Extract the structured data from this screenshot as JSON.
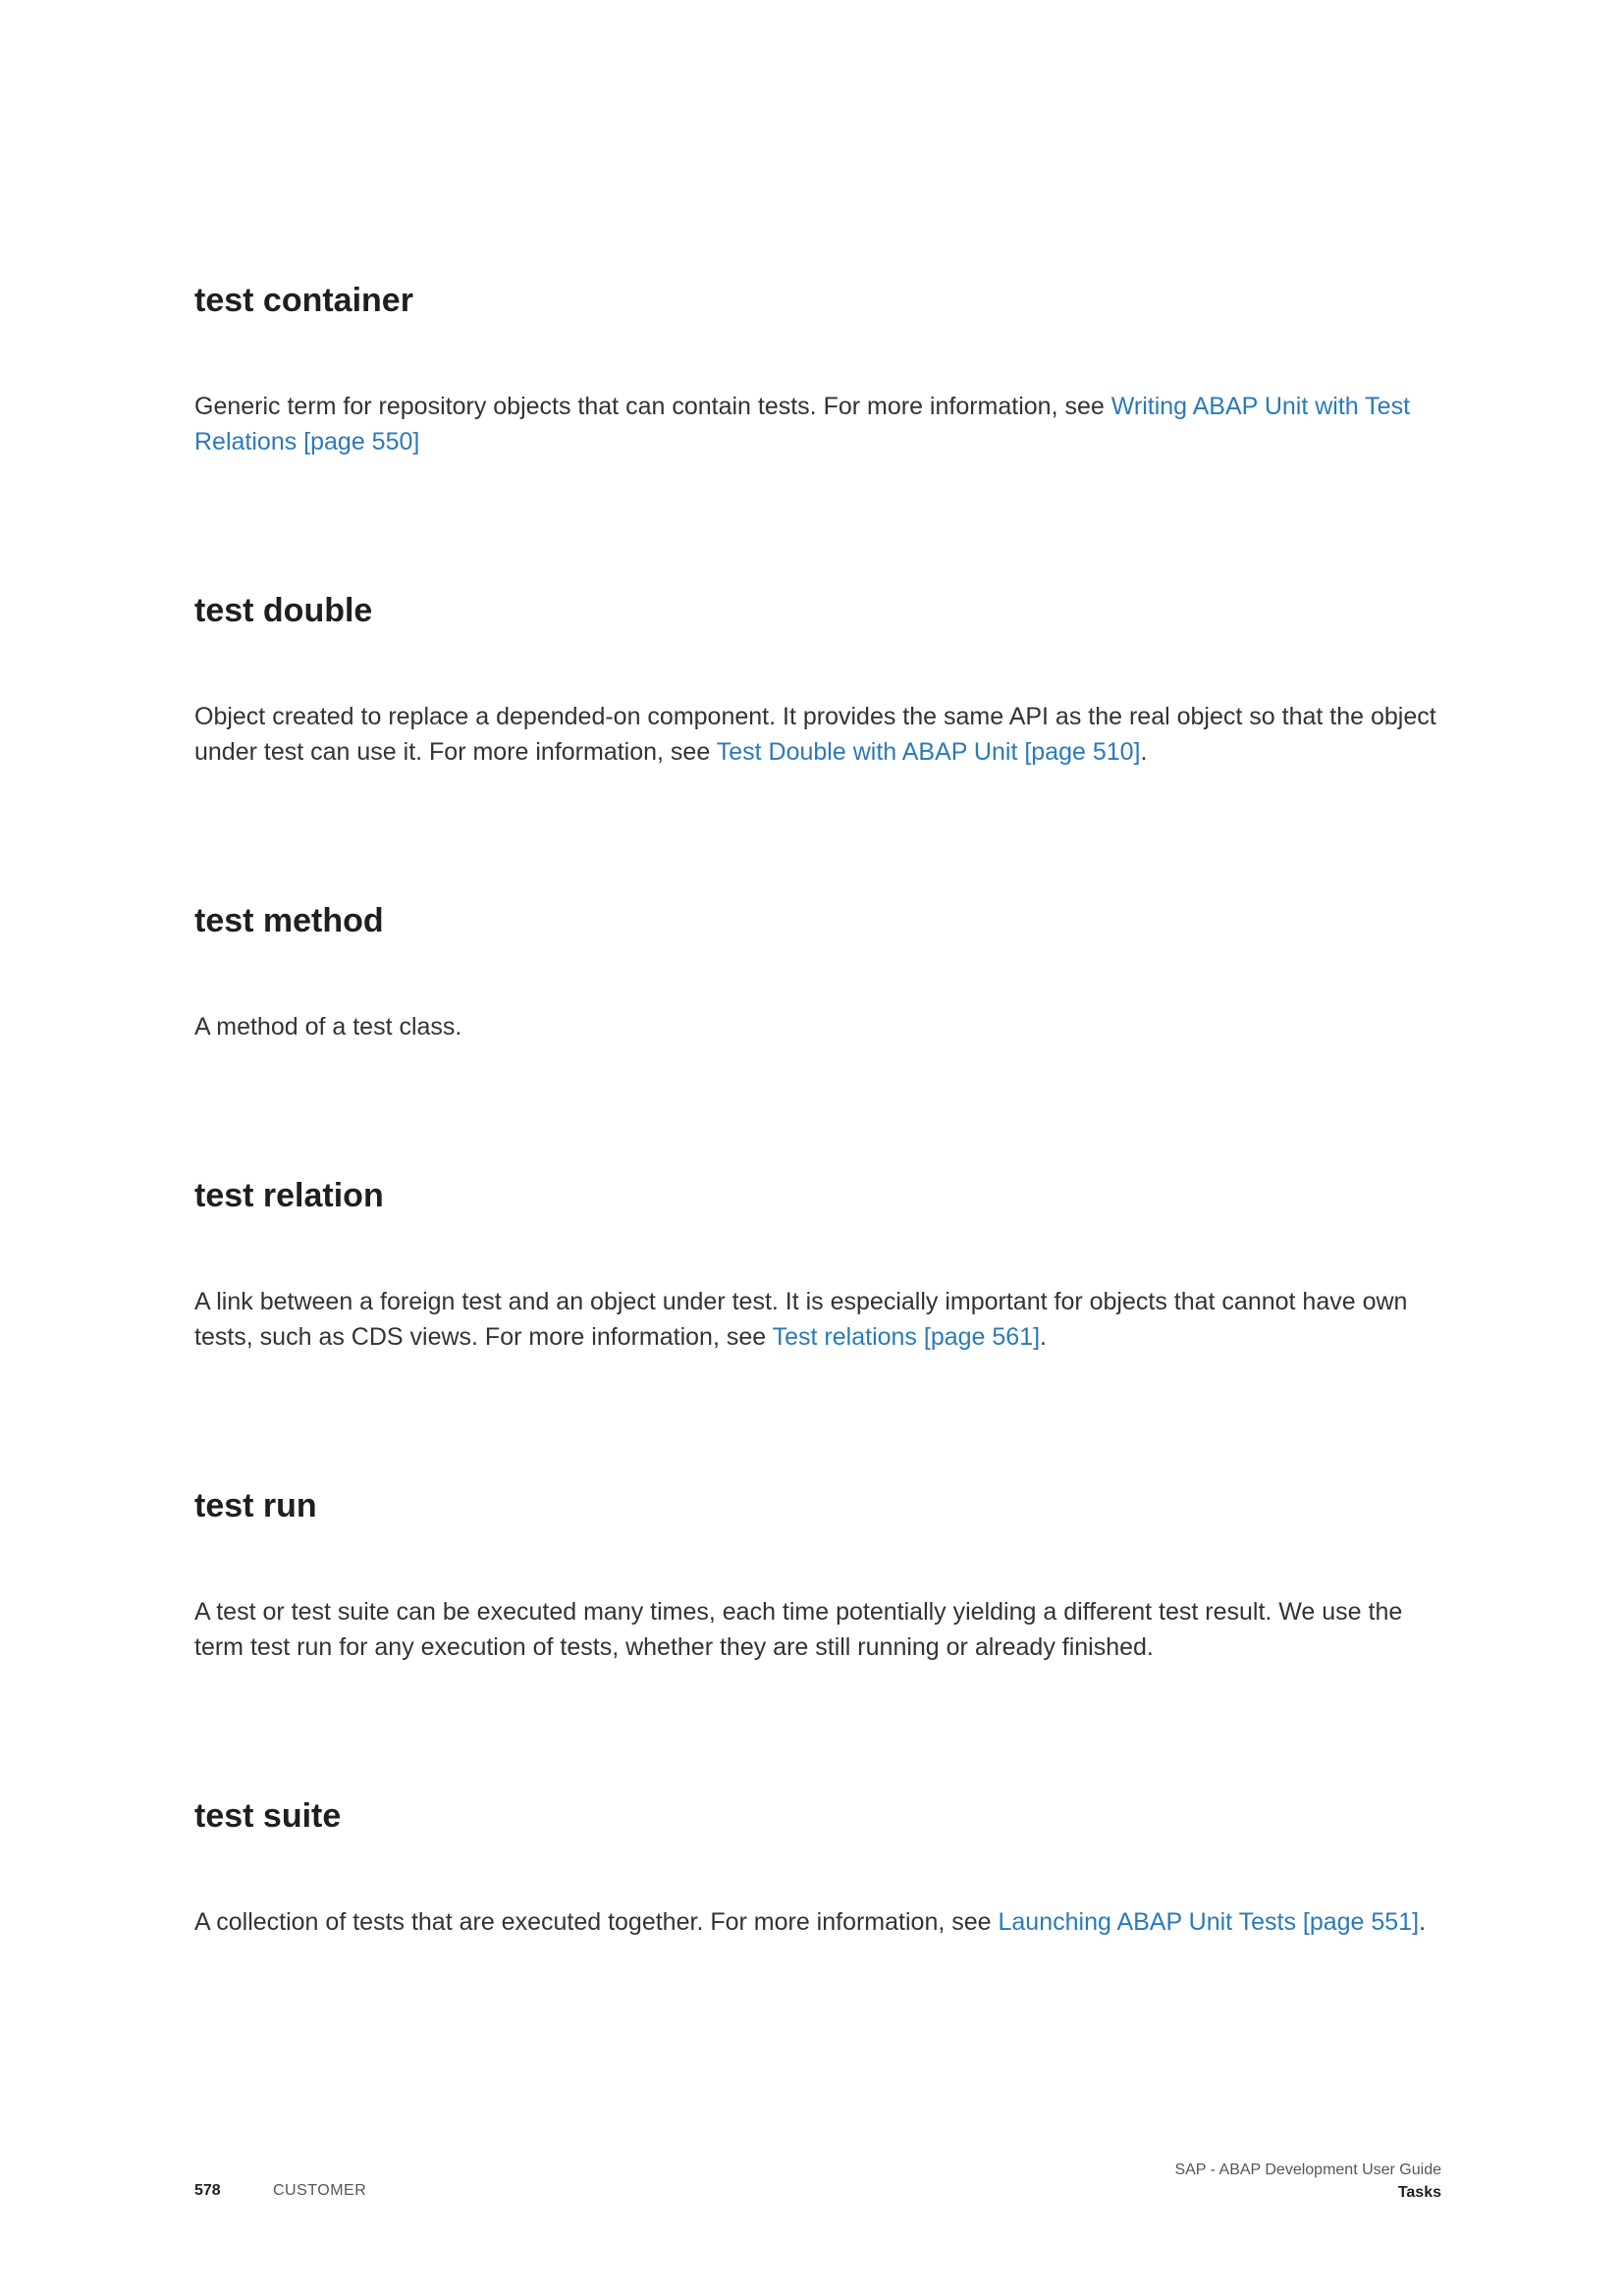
{
  "entries": [
    {
      "term": "test container",
      "text": "Generic term for repository objects that can contain tests. For more information, see ",
      "link": "Writing ABAP Unit with Test Relations [page 550]",
      "after": ""
    },
    {
      "term": "test double",
      "text": "Object created to replace a depended-on component. It provides the same API as the real object so that the object under test can use it. For more information, see ",
      "link": "Test Double with ABAP Unit [page 510]",
      "after": "."
    },
    {
      "term": "test method",
      "text": "A method of a test class.",
      "link": "",
      "after": ""
    },
    {
      "term": "test relation",
      "text": "A link between a foreign test and an object under test. It is especially important for objects that cannot have own tests, such as CDS views. For more information, see ",
      "link": "Test relations [page 561]",
      "after": "."
    },
    {
      "term": "test run",
      "text": "A test or test suite can be executed many times, each time potentially yielding a different test result. We use the term test run for any execution of tests, whether they are still running or already finished.",
      "link": "",
      "after": ""
    },
    {
      "term": "test suite",
      "text": "A collection of tests that are executed together. For more information, see ",
      "link": "Launching ABAP Unit Tests [page 551]",
      "after": "."
    }
  ],
  "footer": {
    "page_number": "578",
    "classification": "CUSTOMER",
    "document_title": "SAP - ABAP Development User Guide",
    "chapter": "Tasks"
  },
  "colors": {
    "link": "#2a7ab8",
    "heading": "#1f1f1f",
    "body_text": "#333333"
  }
}
